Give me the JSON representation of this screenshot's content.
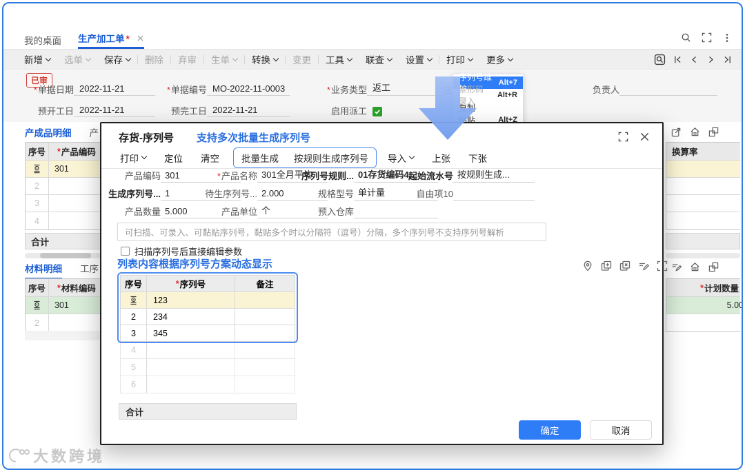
{
  "marks": {
    "required": "*",
    "dirty": "*"
  },
  "tabbar": {
    "tabs": [
      {
        "label": "我的桌面"
      },
      {
        "label": "生产加工单"
      }
    ]
  },
  "toolbar": {
    "items": [
      {
        "label": "新增"
      },
      {
        "label": "选单"
      },
      {
        "label": "保存"
      },
      {
        "label": "删除"
      },
      {
        "label": "弃审"
      },
      {
        "label": "生单"
      },
      {
        "label": "转换"
      },
      {
        "label": "变更"
      },
      {
        "label": "工具"
      },
      {
        "label": "联查"
      },
      {
        "label": "设置"
      },
      {
        "label": "打印"
      },
      {
        "label": "更多"
      }
    ]
  },
  "form": {
    "status_badge": "已审",
    "fields": {
      "doc_date": {
        "label": "单据日期",
        "value": "2022-11-21"
      },
      "doc_no": {
        "label": "单据编号",
        "value": "MO-2022-11-0003"
      },
      "biz_type": {
        "label": "业务类型",
        "value": "返工"
      },
      "clipped": {
        "label": "生"
      },
      "manager": {
        "label": "负责人",
        "value": ""
      },
      "plan_start": {
        "label": "预开工日",
        "value": "2022-11-21"
      },
      "plan_end": {
        "label": "预完工日",
        "value": "2022-11-21"
      },
      "dispatch": {
        "label": "启用派工"
      }
    }
  },
  "context_menu": {
    "items": [
      {
        "label": "序列号维护",
        "shortcut": "Alt+7"
      },
      {
        "label": "条形码录入",
        "shortcut": "Alt+R"
      },
      {
        "label": "复制",
        "shortcut": ""
      },
      {
        "label": "粘贴",
        "shortcut": "Alt+Z"
      }
    ]
  },
  "product_panel": {
    "tab": "产成品明细",
    "tab_next": "产",
    "col_no": "序号",
    "col_code": "产品编码",
    "rows": [
      {
        "code": "301"
      },
      {
        "no": "2"
      },
      {
        "no": "3"
      },
      {
        "no": "4"
      }
    ],
    "footer": "合计"
  },
  "material_panel": {
    "tab": "材料明细",
    "tab_next": "工序",
    "col_no": "序号",
    "col_code": "材料编码",
    "rows": [
      {
        "code": "301"
      },
      {
        "no": "2"
      }
    ]
  },
  "right_top_panel": {
    "col": "换算率"
  },
  "right_bottom_panel": {
    "col": "计划数量",
    "value": "5.00"
  },
  "modal": {
    "title": "存货-序列号",
    "annotation": "支持多次批量生成序列号",
    "toolbar": {
      "print": "打印",
      "locate": "定位",
      "clear": "清空",
      "batch": "批量生成",
      "by_rule": "按规则生成序列号",
      "import": "导入",
      "prev_doc": "上张",
      "next_doc": "下张"
    },
    "fields": {
      "code": {
        "label": "产品编码",
        "value": "301"
      },
      "name": {
        "label": "产品名称",
        "value": "301全月平均"
      },
      "rule": {
        "label": "序列号规则...",
        "value": "01存货编码4..."
      },
      "start_no": {
        "label": "起始流水号",
        "value": "按规则生成..."
      },
      "gen": {
        "label": "生成序列号...",
        "value": "1"
      },
      "pending": {
        "label": "待生序列号...",
        "value": "2.000"
      },
      "spec": {
        "label": "规格型号",
        "value": "单计量"
      },
      "free10": {
        "label": "自由项10",
        "value": ""
      },
      "qty": {
        "label": "产品数量",
        "value": "5.000"
      },
      "unit": {
        "label": "产品单位",
        "value": "个"
      },
      "warehouse": {
        "label": "预入仓库",
        "value": ""
      }
    },
    "hint": "可扫描、可录入、可黏贴序列号，黏贴多个时以分隔符（逗号）分隔，多个序列号不支持序列号解析",
    "checkbox_label": "扫描序列号后直接编辑参数",
    "note": "列表内容根据序列号方案动态显示",
    "table": {
      "col_no": "序号",
      "col_serial": "序列号",
      "col_remark": "备注",
      "rows": [
        {
          "serial": "123"
        },
        {
          "no": "2",
          "serial": "234"
        },
        {
          "no": "3",
          "serial": "345"
        },
        {
          "no": "4"
        },
        {
          "no": "5"
        },
        {
          "no": "6"
        }
      ],
      "footer": "合计"
    },
    "buttons": {
      "ok": "确定",
      "cancel": "取消"
    }
  },
  "watermark": "大数跨境"
}
